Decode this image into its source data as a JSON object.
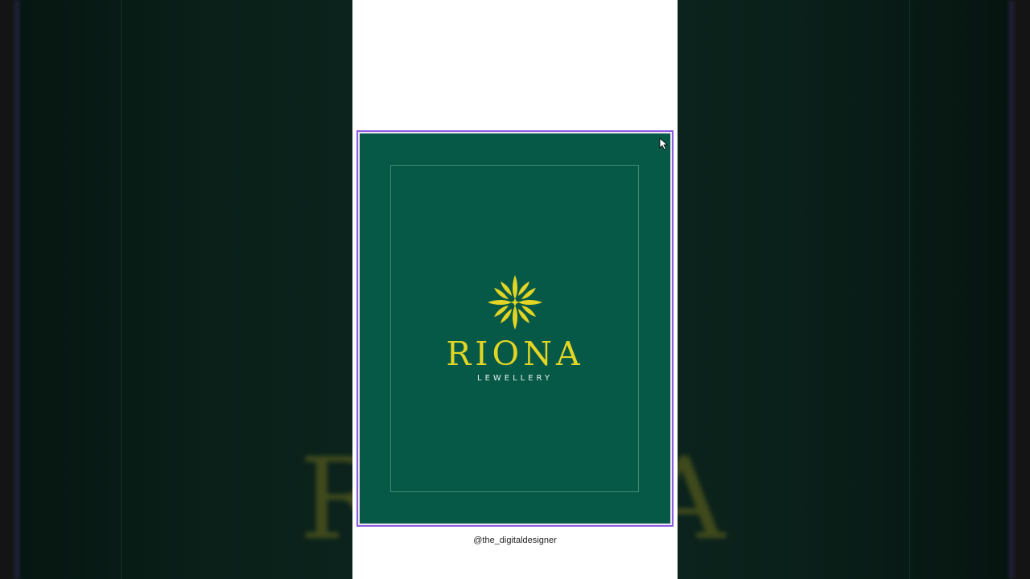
{
  "brand": {
    "name": "RIONA",
    "subtitle": "LEWELLERY"
  },
  "background_ghost": {
    "left_letter": "R",
    "right_letter": "A"
  },
  "watermark": "@the_digitaldesigner",
  "colors": {
    "artboard": "#075947",
    "logo_gold": "#e2d524",
    "selection": "#8d5ce0"
  },
  "icons": {
    "emblem": "floral-emblem-icon",
    "cursor": "mouse-pointer-icon"
  }
}
